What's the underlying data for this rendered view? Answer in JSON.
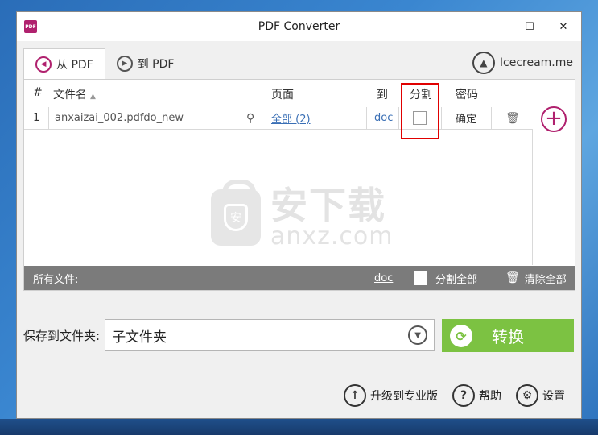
{
  "window": {
    "title": "PDF Converter",
    "app_icon": "PDF"
  },
  "tabs": [
    {
      "label": "从 PDF",
      "active": true
    },
    {
      "label": "到 PDF",
      "active": false
    }
  ],
  "brand": {
    "name": "Icecream.me"
  },
  "table": {
    "headers": {
      "num": "#",
      "filename": "文件名",
      "pages": "页面",
      "to": "到",
      "split": "分割",
      "password": "密码"
    },
    "rows": [
      {
        "num": "1",
        "filename": "anxaizai_002.pdfdo_new",
        "pages": "全部 (2)",
        "format": "doc",
        "split": false,
        "password": "确定"
      }
    ]
  },
  "watermark": {
    "cn": "安下载",
    "en": "anxz.com",
    "shield": "安"
  },
  "footer": {
    "all_files": "所有文件:",
    "format": "doc",
    "split_all": "分割全部",
    "clear_all": "清除全部"
  },
  "save": {
    "label": "保存到文件夹:",
    "folder": "子文件夹"
  },
  "convert": {
    "label": "转换"
  },
  "actions": {
    "upgrade": "升级到专业版",
    "help": "帮助",
    "settings": "设置"
  },
  "colors": {
    "accent": "#b0216e",
    "convert_green": "#7cc242",
    "link": "#3a6fb5",
    "highlight": "#e00000"
  }
}
